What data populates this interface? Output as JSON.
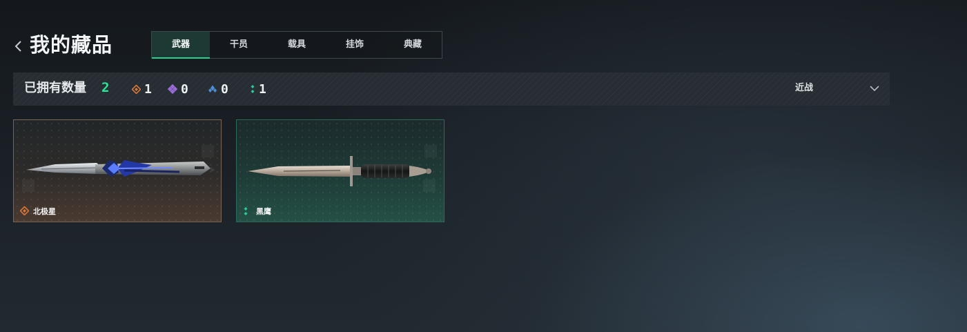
{
  "header": {
    "title": "我的藏品",
    "tabs": [
      {
        "label": "武器",
        "active": true
      },
      {
        "label": "干员",
        "active": false
      },
      {
        "label": "载具",
        "active": false
      },
      {
        "label": "挂饰",
        "active": false
      },
      {
        "label": "典藏",
        "active": false
      }
    ]
  },
  "stats": {
    "owned_label": "已拥有数量",
    "owned_count": "2",
    "owned_count_color": "#2ee39a",
    "rarities": [
      {
        "icon": "orange-diamond-rarity-icon",
        "color": "#d9773b",
        "count": "1"
      },
      {
        "icon": "purple-diamond-rarity-icon",
        "color": "#9a6ad6",
        "count": "0"
      },
      {
        "icon": "blue-triangle-rarity-icon",
        "color": "#4f8fd8",
        "count": "0"
      },
      {
        "icon": "green-dots-rarity-icon",
        "color": "#2cc79a",
        "count": "1"
      }
    ],
    "category_filter": "近战"
  },
  "items": [
    {
      "name": "北极星",
      "rarity_color": "#d9773b",
      "rarity_icon": "orange-diamond-rarity-icon"
    },
    {
      "name": "黑鹰",
      "rarity_color": "#2cc79a",
      "rarity_icon": "green-dots-rarity-icon"
    }
  ],
  "colors": {
    "accent": "#2ccf8e"
  }
}
